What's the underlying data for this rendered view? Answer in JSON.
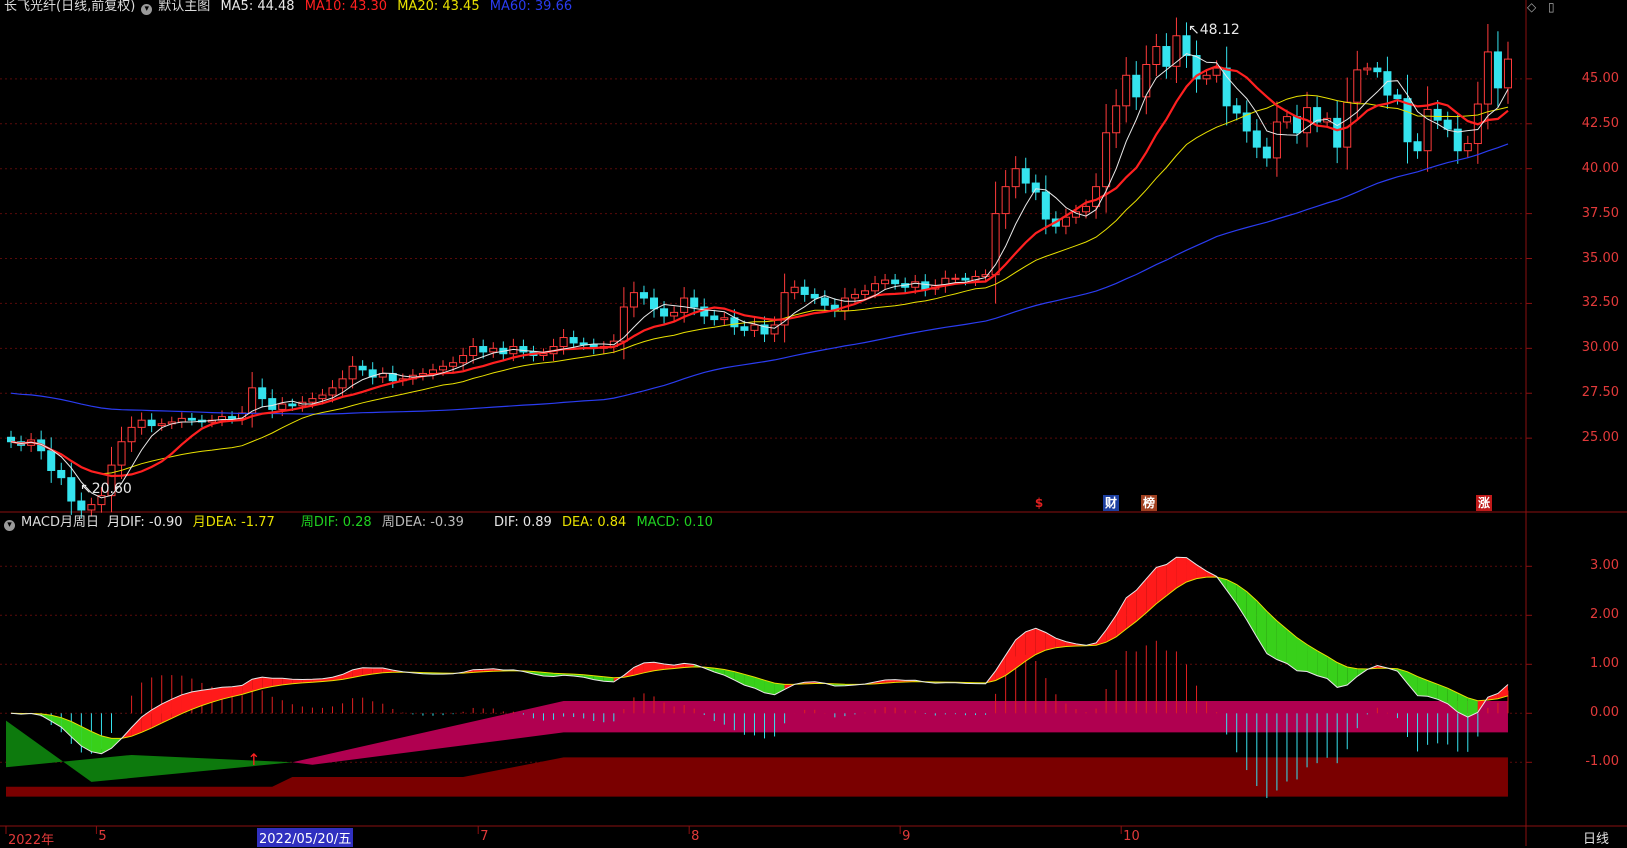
{
  "header": {
    "title": "长飞光纤(日线,前复权)",
    "template": "默认主图",
    "ma": [
      {
        "label": "MA5: 44.48",
        "color": "#e8e8e8"
      },
      {
        "label": "MA10: 43.30",
        "color": "#ff2020"
      },
      {
        "label": "MA20: 43.45",
        "color": "#e8e000"
      },
      {
        "label": "MA60: 39.66",
        "color": "#2a3cf0"
      }
    ]
  },
  "macd_header": {
    "title": "MACD月周日",
    "items": [
      {
        "label": "月DIF: -0.90",
        "color": "#e8e8e8"
      },
      {
        "label": "月DEA: -1.77",
        "color": "#e8e000"
      },
      {
        "label": "周DIF: 0.28",
        "color": "#20d020"
      },
      {
        "label": "周DEA: -0.39",
        "color": "#bbbbbb"
      },
      {
        "label": "DIF: 0.89",
        "color": "#e8e8e8"
      },
      {
        "label": "DEA: 0.84",
        "color": "#e8e000"
      },
      {
        "label": "MACD: 0.10",
        "color": "#20d020"
      }
    ]
  },
  "annotations": {
    "high": "48.12",
    "low": "20.60",
    "cursor_date": "2022/05/20/五",
    "period": "日线"
  },
  "event_markers": [
    {
      "label": "$",
      "color": "#e02020",
      "bg": "transparent"
    },
    {
      "label": "财",
      "color": "#ffffff",
      "bg": "#1c3fa0"
    },
    {
      "label": "榜",
      "color": "#ffffff",
      "bg": "#a04020"
    },
    {
      "label": "涨",
      "color": "#ffffff",
      "bg": "#c01a1a"
    }
  ],
  "icons": {
    "diamond": "diamond-icon",
    "window": "window-icon",
    "info": "info-circle-icon"
  },
  "colors": {
    "up": "#ff3b3b",
    "down": "#35e3ee",
    "grid": "#6e0c0c",
    "axis_text": "#e23a3a"
  },
  "chart_data": [
    {
      "type": "candlestick",
      "title": "长飞光纤(日线,前复权)",
      "ylim": [
        21,
        48.5
      ],
      "y_ticks": [
        "25.00",
        "27.50",
        "30.00",
        "32.50",
        "35.00",
        "37.50",
        "40.00",
        "42.50",
        "45.00"
      ],
      "x_ticks": [
        "2022年",
        "5",
        "7",
        "8",
        "9",
        "10"
      ],
      "dates": [
        "2022-04-11",
        "2022-05-05",
        "2022-07-01",
        "2022-08-01",
        "2022-09-01",
        "2022-10-10"
      ],
      "closes": [
        24.8,
        24.6,
        24.9,
        24.3,
        23.2,
        22.8,
        21.5,
        21.0,
        21.3,
        21.8,
        23.5,
        24.8,
        25.6,
        26.0,
        25.7,
        25.8,
        25.9,
        26.1,
        26.0,
        25.9,
        26.0,
        26.2,
        26.1,
        26.4,
        27.8,
        27.2,
        26.6,
        26.9,
        26.8,
        27.0,
        27.2,
        27.4,
        27.8,
        28.3,
        29.0,
        28.8,
        28.4,
        28.6,
        28.2,
        28.3,
        28.5,
        28.6,
        28.8,
        29.0,
        29.2,
        29.6,
        30.1,
        29.8,
        30.0,
        29.7,
        30.1,
        29.8,
        29.6,
        29.7,
        30.1,
        30.6,
        30.3,
        30.2,
        30.0,
        30.1,
        30.4,
        32.3,
        33.1,
        32.8,
        32.2,
        31.8,
        32.0,
        32.8,
        32.3,
        31.8,
        31.6,
        31.7,
        31.2,
        31.0,
        31.3,
        30.8,
        31.3,
        33.1,
        33.4,
        33.0,
        32.8,
        32.4,
        32.1,
        32.8,
        33.0,
        33.2,
        33.6,
        33.8,
        33.6,
        33.4,
        33.7,
        33.3,
        33.5,
        33.9,
        33.9,
        33.8,
        34.0,
        34.1,
        37.5,
        39.0,
        40.0,
        39.2,
        38.7,
        37.2,
        36.8,
        37.3,
        37.6,
        37.9,
        39.0,
        42.0,
        43.5,
        45.2,
        44.0,
        45.8,
        46.8,
        45.7,
        47.4,
        46.3,
        45.0,
        45.2,
        45.6,
        43.5,
        43.1,
        42.1,
        41.2,
        40.6,
        42.6,
        42.9,
        42.0,
        43.4,
        42.6,
        42.8,
        41.2,
        43.7,
        45.5,
        45.6,
        45.4,
        44.1,
        43.9,
        41.5,
        41.0,
        43.3,
        42.7,
        42.2,
        41.0,
        41.4,
        43.6,
        46.5,
        44.5,
        46.1
      ]
    },
    {
      "type": "line",
      "title": "MACD月周日",
      "ylim": [
        -2.3,
        3.7
      ],
      "y_ticks": [
        "3.00",
        "2.00",
        "1.00",
        "0.00",
        "-1.00"
      ],
      "series": [
        {
          "name": "DIF",
          "values": [
            0.89
          ]
        },
        {
          "name": "DEA",
          "values": [
            0.84
          ]
        },
        {
          "name": "MACD",
          "values": [
            0.1
          ]
        },
        {
          "name": "月DIF",
          "values": [
            -0.9
          ]
        },
        {
          "name": "月DEA",
          "values": [
            -1.77
          ]
        },
        {
          "name": "周DIF",
          "values": [
            0.28
          ]
        },
        {
          "name": "周DEA",
          "values": [
            -0.39
          ]
        }
      ]
    }
  ]
}
